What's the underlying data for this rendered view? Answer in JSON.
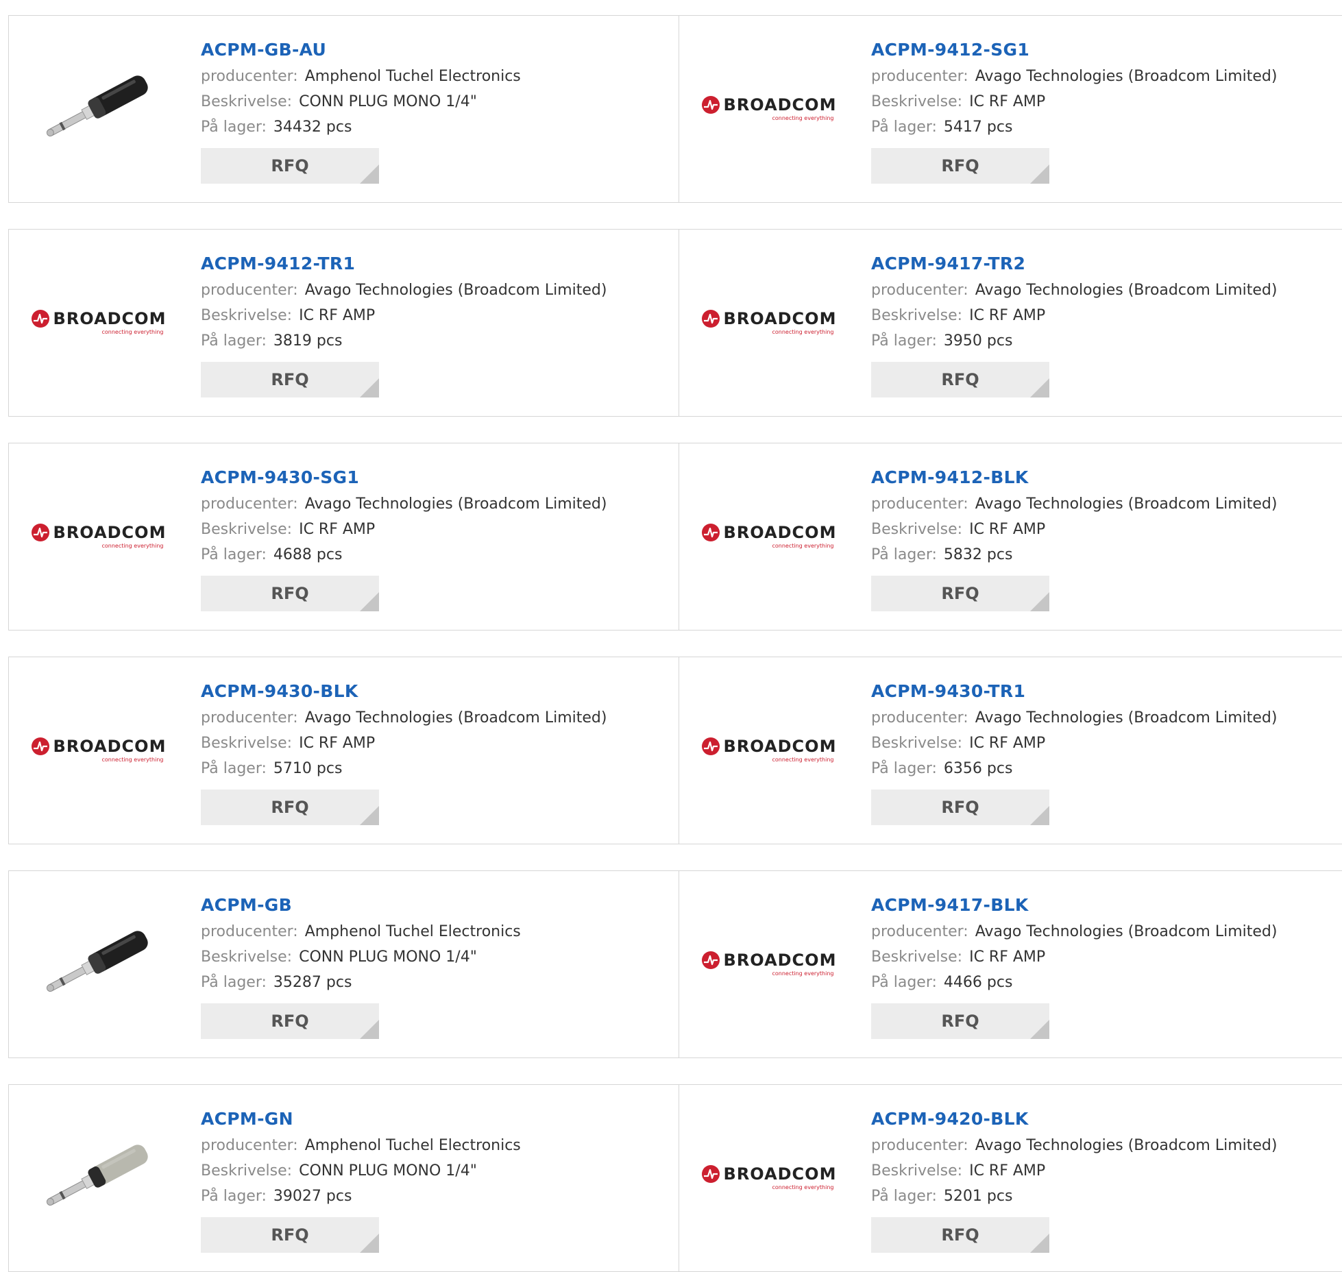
{
  "labels": {
    "manufacturer": "producenter:",
    "description": "Beskrivelse:",
    "stock": "På lager:",
    "rfq": "RFQ"
  },
  "brand_logo": {
    "text": "BROADCOM",
    "tagline": "connecting everything",
    "color": "#cc1f2f"
  },
  "products": [
    {
      "pn": "ACPM-GB-AU",
      "manufacturer": "Amphenol Tuchel Electronics",
      "description": "CONN PLUG MONO 1/4\"",
      "stock": "34432 pcs",
      "image": "jack-plug-black"
    },
    {
      "pn": "ACPM-9412-SG1",
      "manufacturer": "Avago Technologies (Broadcom Limited)",
      "description": "IC RF AMP",
      "stock": "5417 pcs",
      "image": "broadcom-logo"
    },
    {
      "pn": "ACPM-9412-TR1",
      "manufacturer": "Avago Technologies (Broadcom Limited)",
      "description": "IC RF AMP",
      "stock": "3819 pcs",
      "image": "broadcom-logo"
    },
    {
      "pn": "ACPM-9417-TR2",
      "manufacturer": "Avago Technologies (Broadcom Limited)",
      "description": "IC RF AMP",
      "stock": "3950 pcs",
      "image": "broadcom-logo"
    },
    {
      "pn": "ACPM-9430-SG1",
      "manufacturer": "Avago Technologies (Broadcom Limited)",
      "description": "IC RF AMP",
      "stock": "4688 pcs",
      "image": "broadcom-logo"
    },
    {
      "pn": "ACPM-9412-BLK",
      "manufacturer": "Avago Technologies (Broadcom Limited)",
      "description": "IC RF AMP",
      "stock": "5832 pcs",
      "image": "broadcom-logo"
    },
    {
      "pn": "ACPM-9430-BLK",
      "manufacturer": "Avago Technologies (Broadcom Limited)",
      "description": "IC RF AMP",
      "stock": "5710 pcs",
      "image": "broadcom-logo"
    },
    {
      "pn": "ACPM-9430-TR1",
      "manufacturer": "Avago Technologies (Broadcom Limited)",
      "description": "IC RF AMP",
      "stock": "6356 pcs",
      "image": "broadcom-logo"
    },
    {
      "pn": "ACPM-GB",
      "manufacturer": "Amphenol Tuchel Electronics",
      "description": "CONN PLUG MONO 1/4\"",
      "stock": "35287 pcs",
      "image": "jack-plug-black"
    },
    {
      "pn": "ACPM-9417-BLK",
      "manufacturer": "Avago Technologies (Broadcom Limited)",
      "description": "IC RF AMP",
      "stock": "4466 pcs",
      "image": "broadcom-logo"
    },
    {
      "pn": "ACPM-GN",
      "manufacturer": "Amphenol Tuchel Electronics",
      "description": "CONN PLUG MONO 1/4\"",
      "stock": "39027 pcs",
      "image": "jack-plug-silver"
    },
    {
      "pn": "ACPM-9420-BLK",
      "manufacturer": "Avago Technologies (Broadcom Limited)",
      "description": "IC RF AMP",
      "stock": "5201 pcs",
      "image": "broadcom-logo"
    }
  ],
  "colors": {
    "link": "#1c63b7",
    "label": "#8a8a8a",
    "button_bg": "#ececec",
    "border": "#d6d6d6"
  }
}
